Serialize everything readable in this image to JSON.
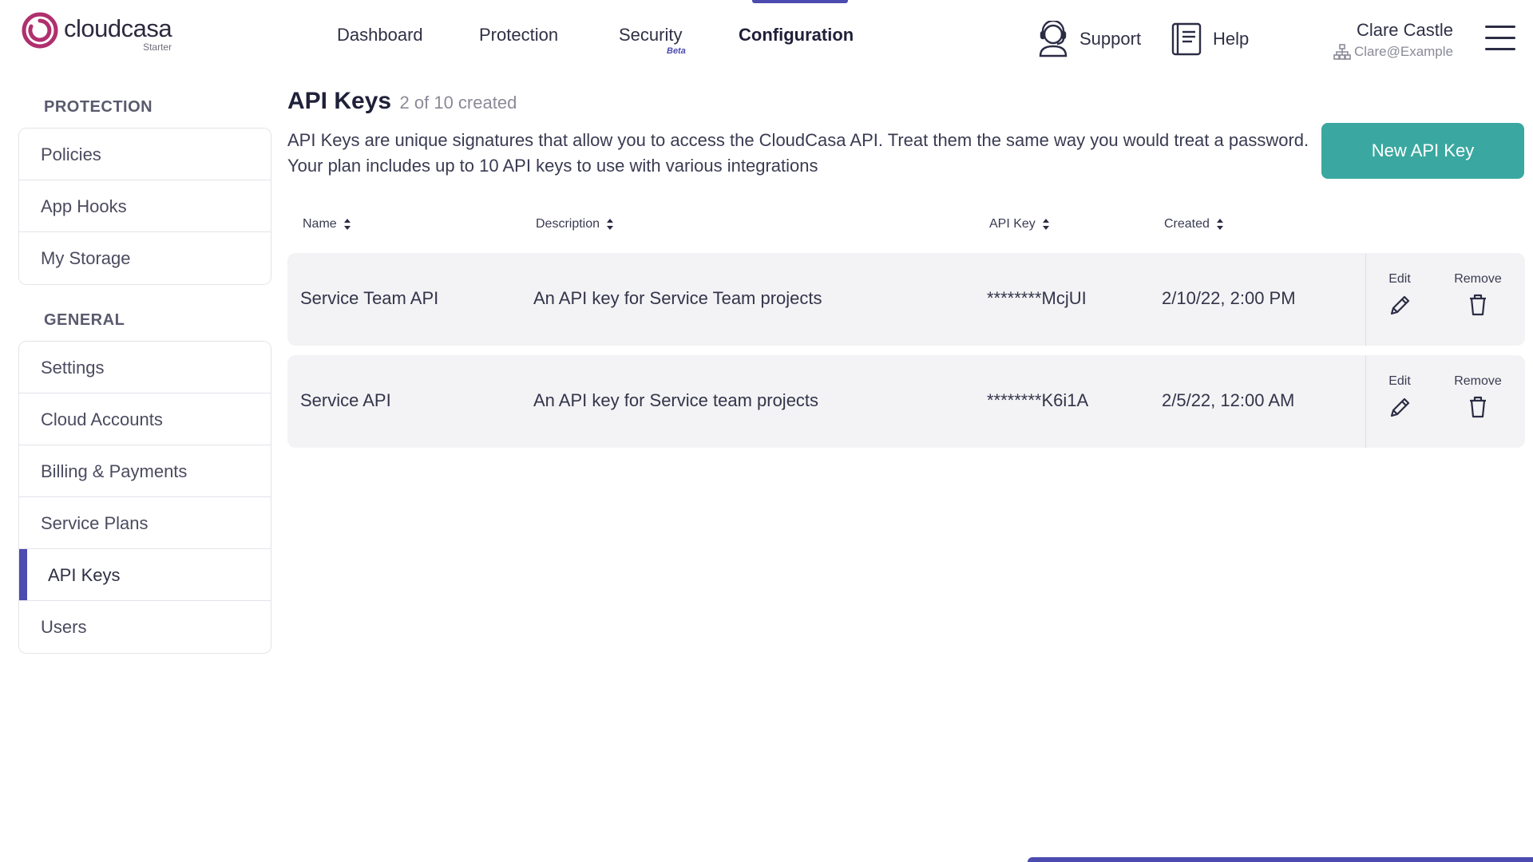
{
  "logo": {
    "word": "cloudcasa",
    "tier": "Starter",
    "brand_color": "#b0306e"
  },
  "nav": {
    "items": [
      {
        "label": "Dashboard"
      },
      {
        "label": "Protection"
      },
      {
        "label": "Security",
        "badge": "Beta"
      },
      {
        "label": "Configuration",
        "active": true
      }
    ],
    "accent": "#4b4bb0"
  },
  "header": {
    "support_label": "Support",
    "support_icon": "headset-icon",
    "help_label": "Help",
    "help_icon": "book-icon",
    "user_name": "Clare Castle",
    "user_org": "Clare@Example",
    "menu_icon": "hamburger-icon"
  },
  "sidebar": {
    "protection_heading": "PROTECTION",
    "protection_items": [
      "Policies",
      "App Hooks",
      "My Storage"
    ],
    "general_heading": "GENERAL",
    "general_items": [
      "Settings",
      "Cloud Accounts",
      "Billing & Payments",
      "Service Plans",
      "API Keys",
      "Users"
    ],
    "active_item": "API Keys"
  },
  "main": {
    "title": "API Keys",
    "count": "2 of 10 created",
    "description": "API Keys are unique signatures that allow you to access the CloudCasa API. Treat them the same way you would treat a password. Your plan includes up to 10 API keys to use with various integrations",
    "new_button": "New API Key",
    "button_color": "#3aa8a0",
    "columns": [
      "Name",
      "Description",
      "API Key",
      "Created"
    ],
    "edit_label": "Edit",
    "remove_label": "Remove",
    "rows": [
      {
        "name": "Service Team API",
        "description": "An API key for Service Team projects",
        "key": "********McjUI",
        "created": "2/10/22, 2:00 PM"
      },
      {
        "name": "Service API",
        "description": "An API key for Service team projects",
        "key": "********K6i1A",
        "created": "2/5/22, 12:00 AM"
      }
    ]
  }
}
